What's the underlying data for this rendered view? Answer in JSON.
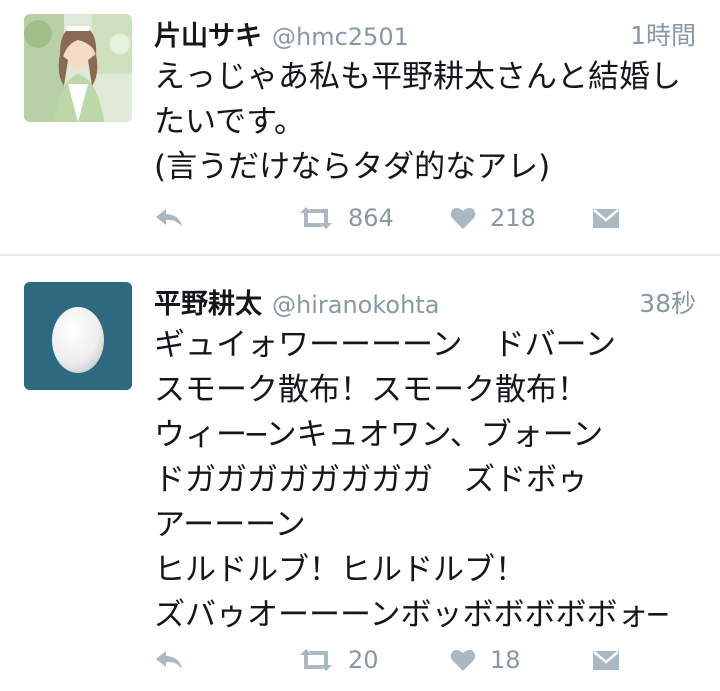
{
  "tweets": [
    {
      "name": "片山サキ",
      "handle": "@hmc2501",
      "time": "1時間",
      "lines": [
        "えっじゃあ私も平野耕太さんと結婚し",
        "たいです。",
        "(言うだけならタダ的なアレ)"
      ],
      "retweets": "864",
      "likes": "218",
      "avatar_icon": "profile-photo"
    },
    {
      "name": "平野耕太",
      "handle": "@hiranokohta",
      "time": "38秒",
      "lines": [
        "ギュイォワーーーーン　ドバーン",
        "スモーク散布！スモーク散布！",
        "ウィー─ンキュオワン、ブォーン",
        "ドガガガガガガガガ　ズドボゥ",
        "アーーーン",
        "ヒルドルブ！ヒルドルブ！",
        "ズバゥオーーーンボッボボボボボォ─"
      ],
      "retweets": "20",
      "likes": "18",
      "avatar_icon": "default-egg-avatar"
    }
  ],
  "colors": {
    "text": "#14171a",
    "muted": "#8899a6",
    "icon": "#aab8c2",
    "divider": "#e6ecf0",
    "egg_background": "#2d6a7f"
  }
}
